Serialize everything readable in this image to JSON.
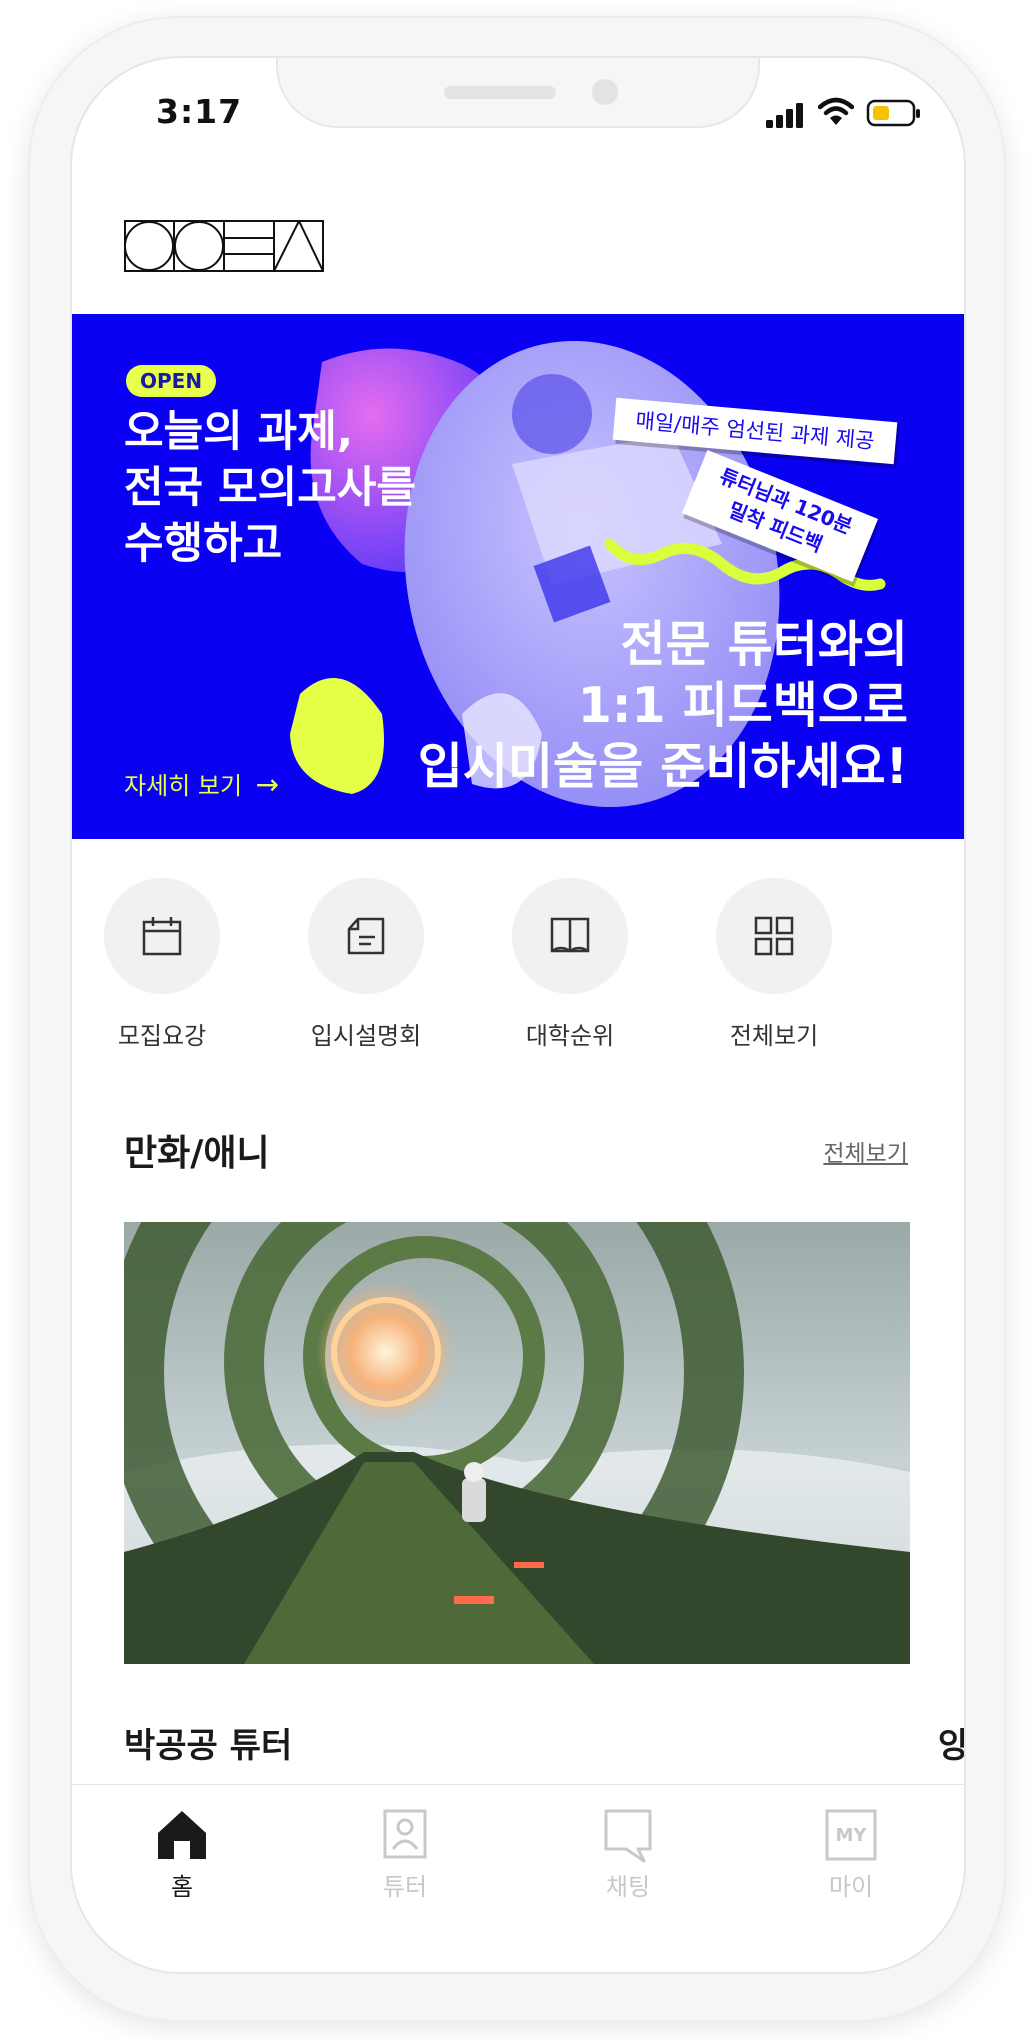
{
  "status_bar": {
    "time": "3:17"
  },
  "banner": {
    "badge": "OPEN",
    "title": "오늘의 과제,\n전국 모의고사를\n수행하고",
    "tag_1": "매일/매주 엄선된 과제 제공",
    "tag_2": "튜터님과 120분\n밀착 피드백",
    "subtitle": "전문 튜터와의\n1:1 피드백으로\n입시미술을 준비하세요!",
    "detail_link": "자세히 보기",
    "accent_color": "#e8ff4d",
    "background_color": "#0a00f4"
  },
  "categories": [
    {
      "label": "모집요강",
      "icon": "calendar-icon"
    },
    {
      "label": "입시설명회",
      "icon": "document-icon"
    },
    {
      "label": "대학순위",
      "icon": "book-icon"
    },
    {
      "label": "전체보기",
      "icon": "grid-icon"
    }
  ],
  "section": {
    "title": "만화/애니",
    "more": "전체보기"
  },
  "cards": [
    {
      "tutor": "박공공 튜터"
    },
    {
      "tutor": "양"
    }
  ],
  "tabbar": [
    {
      "label": "홈",
      "icon": "home-icon",
      "active": true
    },
    {
      "label": "튜터",
      "icon": "tutor-icon",
      "active": false
    },
    {
      "label": "채팅",
      "icon": "chat-icon",
      "active": false
    },
    {
      "label": "마이",
      "icon": "my-icon",
      "icon_text": "MY",
      "active": false
    }
  ],
  "colors": {
    "active_tab": "#1a1a1a",
    "inactive_tab": "#c8c8c8"
  }
}
